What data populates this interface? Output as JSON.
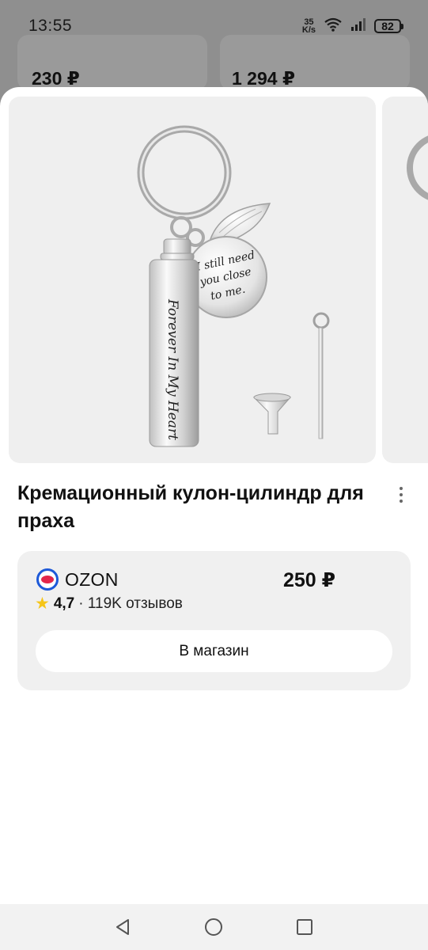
{
  "status_bar": {
    "time": "13:55",
    "net_speed_value": "35",
    "net_speed_unit": "K/s",
    "battery": "82"
  },
  "background": {
    "left_price": "230 ₽",
    "right_price": "1 294 ₽"
  },
  "product": {
    "title": "Кремационный кулон-цилиндр для праха",
    "image_texts": {
      "tag_lines": [
        "I still need",
        "you close",
        "to me."
      ],
      "cylinder_text": "Forever In My Heart"
    }
  },
  "offer": {
    "shop_name": "OZON",
    "price": "250 ₽",
    "rating": "4,7",
    "reviews": "· 119K отзывов",
    "button_label": "В магазин"
  },
  "colors": {
    "overlay": "#8f8f8f",
    "offer_bg": "#f0f0f0",
    "ozon_blue": "#1d59d8",
    "ozon_red": "#e2264b",
    "star": "#f5c518"
  },
  "icons": {
    "wifi": "wifi-icon",
    "signal": "signal-icon",
    "battery": "battery-icon",
    "more": "more-vertical-icon",
    "back": "back-triangle-icon",
    "home": "home-circle-icon",
    "recents": "recents-square-icon"
  }
}
